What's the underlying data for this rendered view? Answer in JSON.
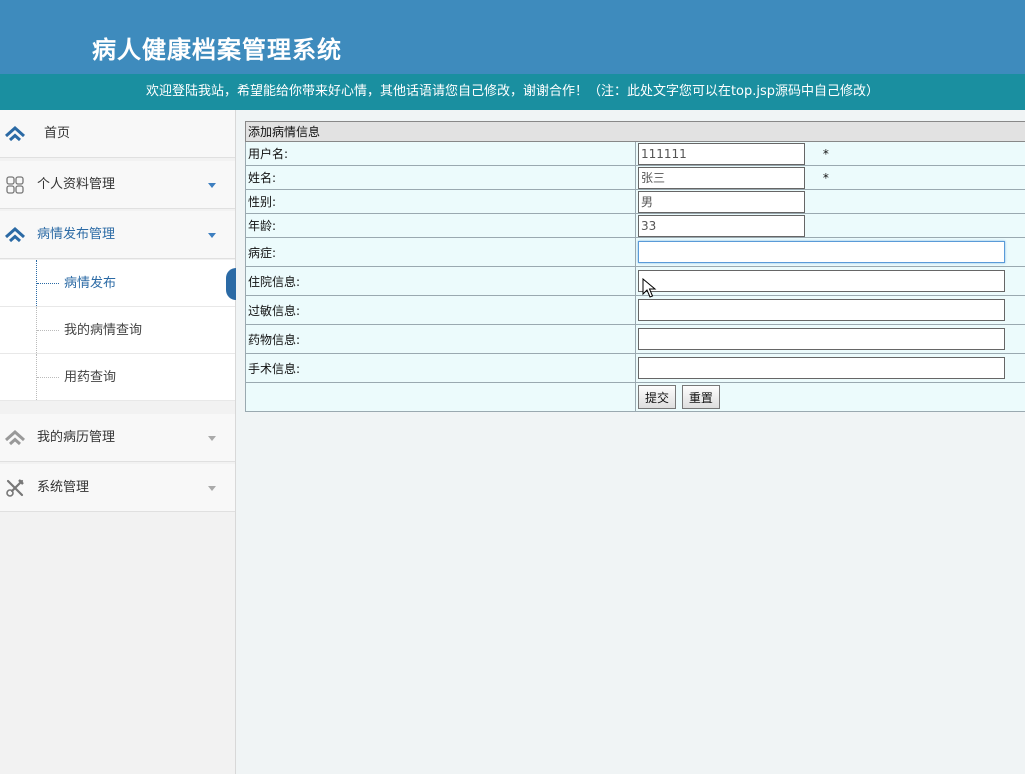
{
  "header": {
    "site_title": "病人健康档案管理系统",
    "welcome_text": "欢迎登陆我站，希望能给你带来好心情，其他话语请您自己修改，谢谢合作！（注：此处文字您可以在top.jsp源码中自己修改）"
  },
  "sidebar": {
    "home": "首页",
    "profile": "个人资料管理",
    "condition_publish_manage": "病情发布管理",
    "sub_items": [
      "病情发布",
      "我的病情查询",
      "用药查询"
    ],
    "records": "我的病历管理",
    "system": "系统管理"
  },
  "form": {
    "title": "添加病情信息",
    "fields": [
      {
        "label": "用户名:",
        "value": "111111",
        "required": "*"
      },
      {
        "label": "姓名:",
        "value": "张三",
        "required": "*"
      },
      {
        "label": "性别:",
        "value": "男"
      },
      {
        "label": "年龄:",
        "value": "33"
      },
      {
        "label": "病症:",
        "value": ""
      },
      {
        "label": "住院信息:",
        "value": ""
      },
      {
        "label": "过敏信息:",
        "value": ""
      },
      {
        "label": "药物信息:",
        "value": ""
      },
      {
        "label": "手术信息:",
        "value": ""
      }
    ],
    "submit_label": "提交",
    "reset_label": "重置"
  },
  "colors": {
    "header_bg": "#3e8bbd",
    "welcome_bg": "#1a8fa0",
    "accent": "#2b6aa5",
    "form_row_bg": "#ecfbfc"
  },
  "icons": {
    "home": "home-chevron-icon",
    "profile": "grid-icon",
    "condition": "home-chevron-icon",
    "records": "home-chevron-icon",
    "system": "tools-icon"
  }
}
